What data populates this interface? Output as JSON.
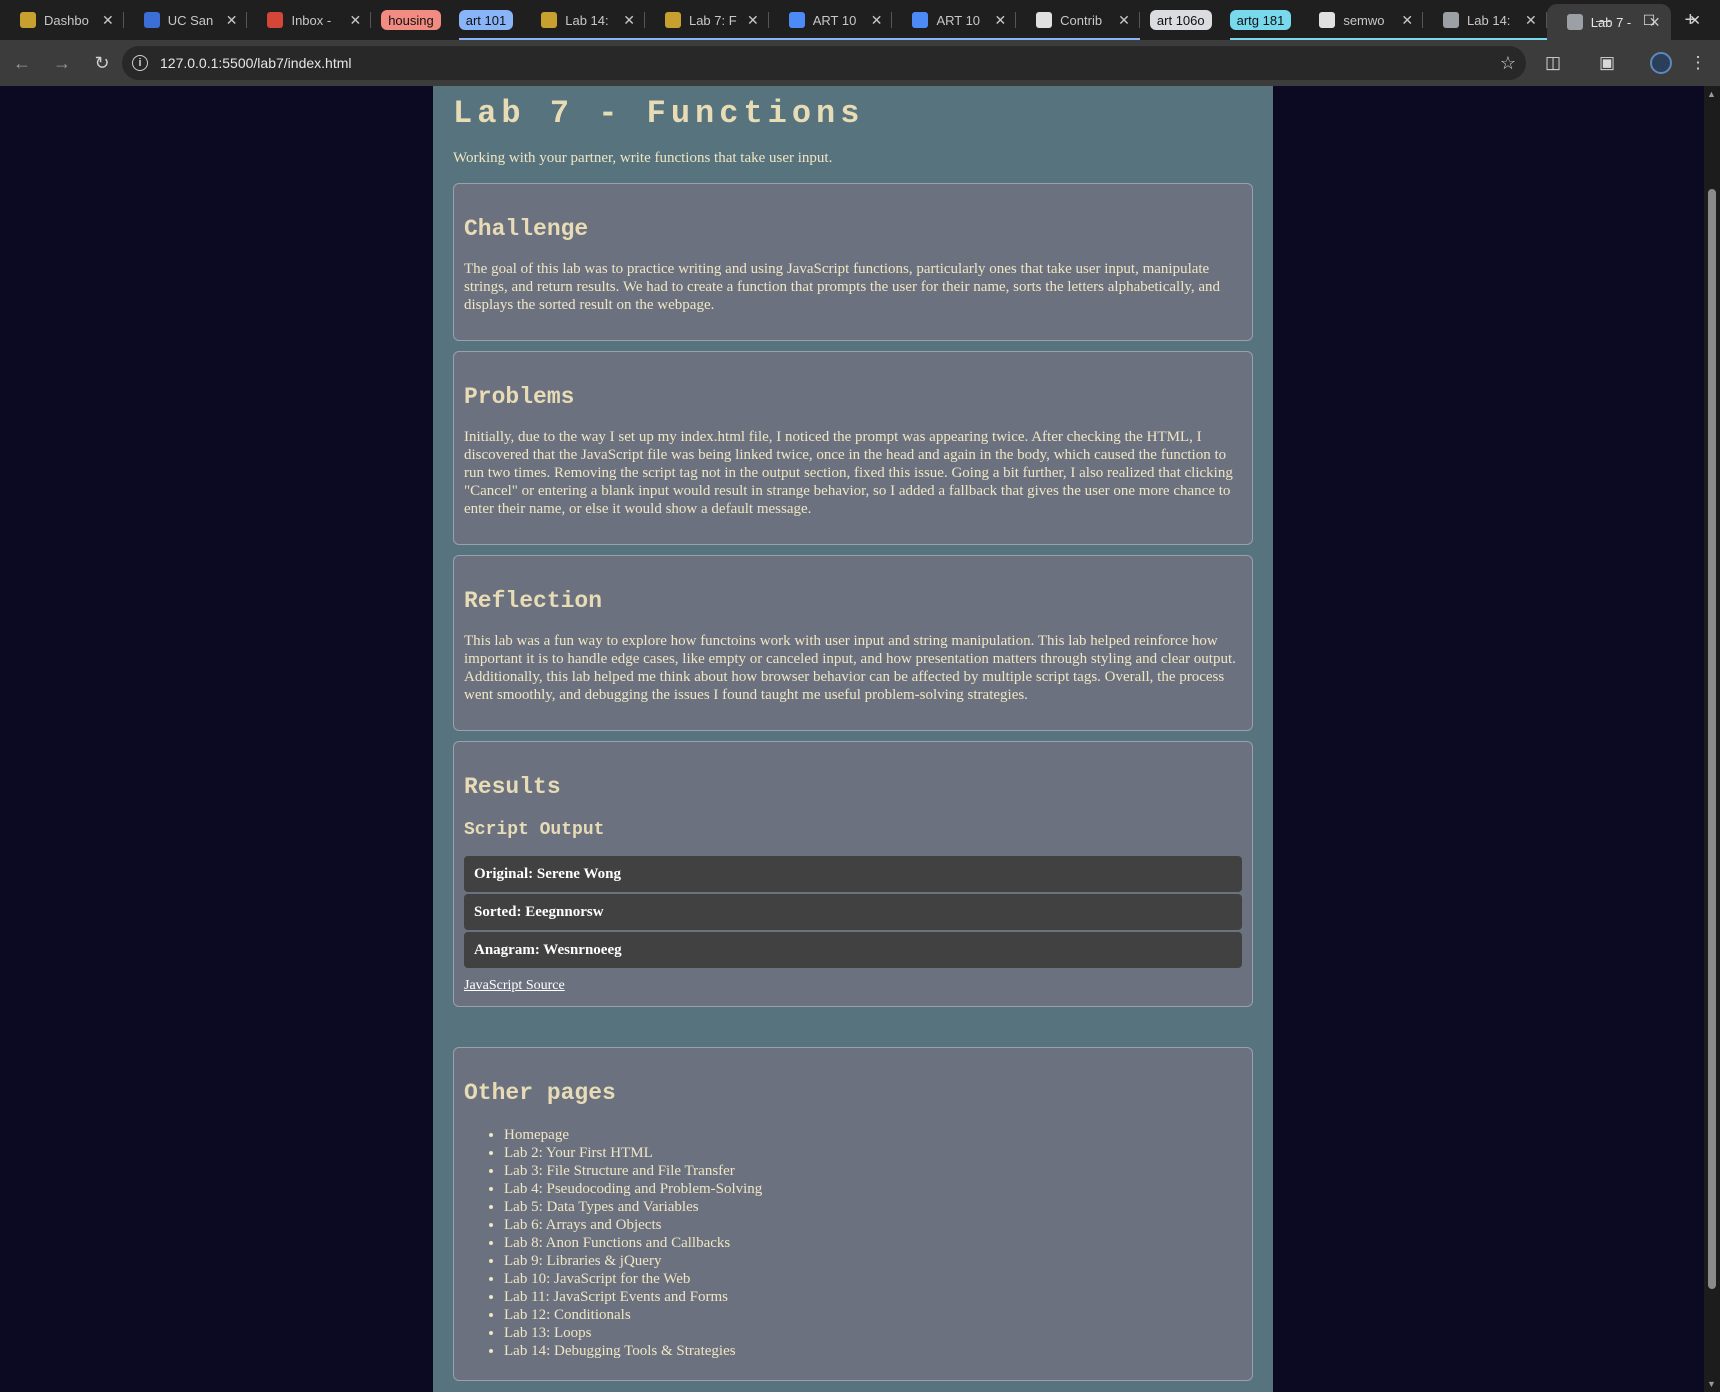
{
  "browser": {
    "tabs": [
      {
        "title": "Dashbo",
        "favicon_color": "#c8a030"
      },
      {
        "title": "UC San",
        "favicon_color": "#3b6fd6"
      },
      {
        "title": "Inbox -",
        "favicon_color": "#d44638"
      }
    ],
    "groups": [
      {
        "label": "housing",
        "color": "#f28b82",
        "tabs": []
      },
      {
        "label": "art 101",
        "color": "#8ab4f8",
        "tabs": [
          {
            "title": "Lab 14:",
            "favicon_color": "#c8a030"
          },
          {
            "title": "Lab 7: F",
            "favicon_color": "#c8a030"
          },
          {
            "title": "ART 10",
            "favicon_color": "#4c8bf5"
          },
          {
            "title": "ART 10",
            "favicon_color": "#4c8bf5"
          },
          {
            "title": "Contrib",
            "favicon_color": "#e0e0e0"
          }
        ]
      },
      {
        "label": "art 106o",
        "color": "#dadce0",
        "tabs": []
      },
      {
        "label": "artg 181",
        "color": "#78d9ec",
        "tabs": [
          {
            "title": "semwo",
            "favicon_color": "#e0e0e0"
          },
          {
            "title": "Lab 14:",
            "favicon_color": "#9aa0a6"
          }
        ]
      }
    ],
    "active_tab": {
      "title": "Lab 7 -",
      "favicon_color": "#9aa0a6"
    },
    "url": "127.0.0.1:5500/lab7/index.html",
    "icons": {
      "back": "arrow-left-icon",
      "forward": "arrow-right-icon",
      "reload": "reload-icon",
      "info": "info-icon",
      "bookmark": "star-icon",
      "extensions": "puzzle-icon",
      "search_tabs": "tab-search-icon",
      "profile": "avatar-icon",
      "menu": "kebab-menu-icon"
    }
  },
  "page": {
    "title": "Lab 7 - Functions",
    "intro": "Working with your partner, write functions that take user input.",
    "challenge": {
      "heading": "Challenge",
      "text": "The goal of this lab was to practice writing and using JavaScript functions, particularly ones that take user input, manipulate strings, and return results. We had to create a function that prompts the user for their name, sorts the letters alphabetically, and displays the sorted result on the webpage."
    },
    "problems": {
      "heading": "Problems",
      "text": "Initially, due to the way I set up my index.html file, I noticed the prompt was appearing twice. After checking the HTML, I discovered that the JavaScript file was being linked twice, once in the head and again in the body, which caused the function to run two times. Removing the script tag not in the output section, fixed this issue. Going a bit further, I also realized that clicking \"Cancel\" or entering a blank input would result in strange behavior, so I added a fallback that gives the user one more chance to enter their name, or else it would show a default message."
    },
    "reflection": {
      "heading": "Reflection",
      "text": "This lab was a fun way to explore how functoins work with user input and string manipulation. This lab helped reinforce how important it is to handle edge cases, like empty or canceled input, and how presentation matters through styling and clear output. Additionally, this lab helped me think about how browser behavior can be affected by multiple script tags. Overall, the process went smoothly, and debugging the issues I found taught me useful problem-solving strategies."
    },
    "results": {
      "heading": "Results",
      "subheading": "Script Output",
      "outputs": [
        "Original: Serene Wong",
        "Sorted: Eeegnnorsw",
        "Anagram: Wesnrnoeeg"
      ],
      "source_link": "JavaScript Source"
    },
    "other_pages": {
      "heading": "Other pages",
      "links": [
        "Homepage",
        "Lab 2: Your First HTML",
        "Lab 3: File Structure and File Transfer",
        "Lab 4: Pseudocoding and Problem-Solving",
        "Lab 5: Data Types and Variables",
        "Lab 6: Arrays and Objects",
        "Lab 8: Anon Functions and Callbacks",
        "Lab 9: Libraries & jQuery",
        "Lab 10: JavaScript for the Web",
        "Lab 11: JavaScript Events and Forms",
        "Lab 12: Conditionals",
        "Lab 13: Loops",
        "Lab 14: Debugging Tools & Strategies"
      ]
    }
  }
}
